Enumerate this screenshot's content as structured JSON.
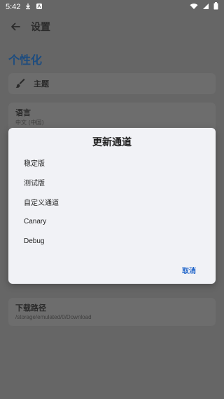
{
  "status": {
    "time": "5:42",
    "icons": [
      "download-icon",
      "app-badge-icon",
      "wifi-icon",
      "signal-icon",
      "battery-icon"
    ]
  },
  "appbar": {
    "title": "设置",
    "back_icon": "arrow-left-icon"
  },
  "section": {
    "title": "个性化"
  },
  "settings": {
    "theme": {
      "label": "主题",
      "icon": "brush-icon"
    },
    "language": {
      "title": "语言",
      "value": "中文 (中国)"
    },
    "download": {
      "title": "下载路径",
      "value": "/storage/emulated/0/Download"
    }
  },
  "dialog": {
    "title": "更新通道",
    "options": [
      "稳定版",
      "测试版",
      "自定义通道",
      "Canary",
      "Debug"
    ],
    "cancel": "取消"
  },
  "colors": {
    "scrim": "#666666",
    "accent": "#1e63c9",
    "section_title": "#1d4c7f",
    "dialog_bg": "#f1f2f6"
  }
}
